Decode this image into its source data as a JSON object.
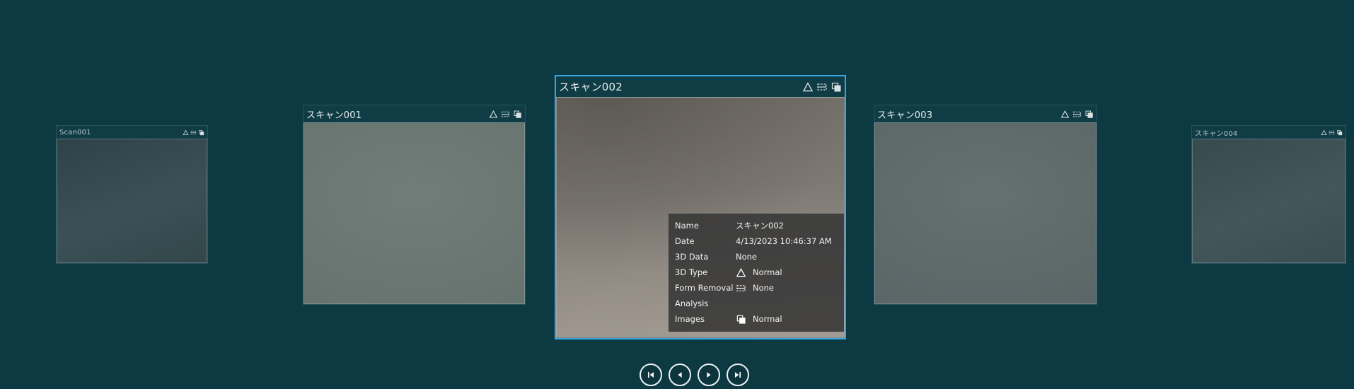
{
  "app": {
    "background": "#0c3942",
    "accent": "#39a5e2",
    "info_panel_bg": "#383838"
  },
  "cards": [
    {
      "title": "Scan001",
      "thumb": "linear-gradient(160deg, #2e4347 0%, #3b5155 55%, #33474b 100%)"
    },
    {
      "title": "スキャン001",
      "thumb": "radial-gradient(130% 100% at 50% 40%, #707d79 0%, #66736f 70%, #5c6965 100%)"
    },
    {
      "title": "スキャン002",
      "selected": true,
      "thumb": "radial-gradient(140% 120% at 18% 0%, rgba(40,38,36,0.28), rgba(0,0,0,0) 60%), linear-gradient(175deg, #716c67 0%, #7d7872 40%, #968f88 75%, #a39c94 100%)"
    },
    {
      "title": "スキャン003",
      "thumb": "radial-gradient(130% 100% at 50% 40%, #65716f 0%, #5a6667 70%, #515d5e 100%)"
    },
    {
      "title": "スキャン004",
      "thumb": "linear-gradient(160deg, #374b4f 0%, #43575b 55%, #3a4e52 100%)"
    }
  ],
  "info": {
    "rows": [
      {
        "label": "Name",
        "icon": "",
        "value": "スキャン002"
      },
      {
        "label": "Date",
        "icon": "",
        "value": "4/13/2023 10:46:37 AM"
      },
      {
        "label": "3D Data",
        "icon": "",
        "value": "None"
      },
      {
        "label": "3D Type",
        "icon": "triangle",
        "value": "Normal"
      },
      {
        "label": "Form Removal",
        "icon": "form-removal",
        "value": "None"
      },
      {
        "label": "Analysis",
        "icon": "",
        "value": ""
      },
      {
        "label": "Images",
        "icon": "images",
        "value": "Normal"
      }
    ]
  },
  "nav": {
    "buttons": [
      {
        "name": "go to first"
      },
      {
        "name": "previous"
      },
      {
        "name": "next"
      },
      {
        "name": "go to last"
      }
    ]
  }
}
